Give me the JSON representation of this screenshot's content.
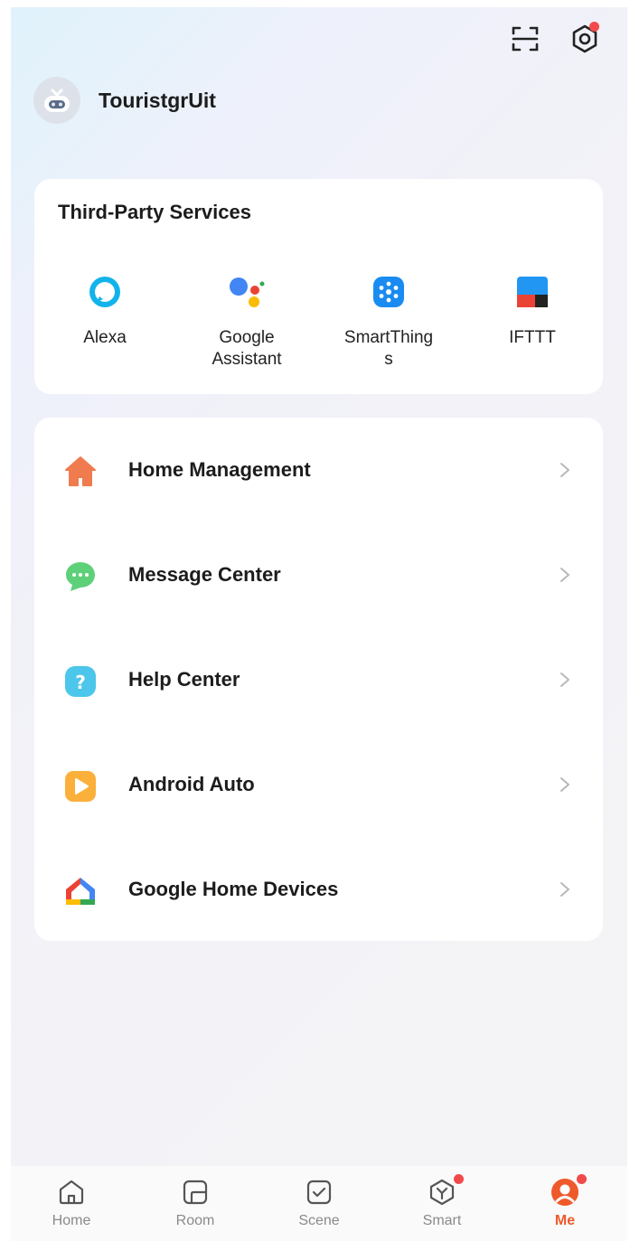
{
  "header": {
    "username": "TouristgrUit"
  },
  "services": {
    "title": "Third-Party Services",
    "items": [
      {
        "label": "Alexa",
        "icon": "alexa-icon"
      },
      {
        "label": "Google\nAssistant",
        "icon": "google-assistant-icon"
      },
      {
        "label": "SmartThing\ns",
        "icon": "smartthings-icon"
      },
      {
        "label": "IFTTT",
        "icon": "ifttt-icon"
      }
    ]
  },
  "menu": {
    "items": [
      {
        "label": "Home Management",
        "icon": "home-icon",
        "color": "#f07b4f"
      },
      {
        "label": "Message Center",
        "icon": "message-icon",
        "color": "#5fd07a"
      },
      {
        "label": "Help Center",
        "icon": "help-icon",
        "color": "#4cc6ea"
      },
      {
        "label": "Android Auto",
        "icon": "android-auto-icon",
        "color": "#fbb03b"
      },
      {
        "label": "Google Home Devices",
        "icon": "google-home-icon"
      }
    ]
  },
  "tabs": [
    {
      "label": "Home",
      "icon": "home-tab-icon",
      "active": false
    },
    {
      "label": "Room",
      "icon": "room-tab-icon",
      "active": false
    },
    {
      "label": "Scene",
      "icon": "scene-tab-icon",
      "active": false
    },
    {
      "label": "Smart",
      "icon": "smart-tab-icon",
      "active": false
    },
    {
      "label": "Me",
      "icon": "me-tab-icon",
      "active": true
    }
  ],
  "colors": {
    "accent": "#ef5a2a",
    "badge": "#f24a4a"
  }
}
